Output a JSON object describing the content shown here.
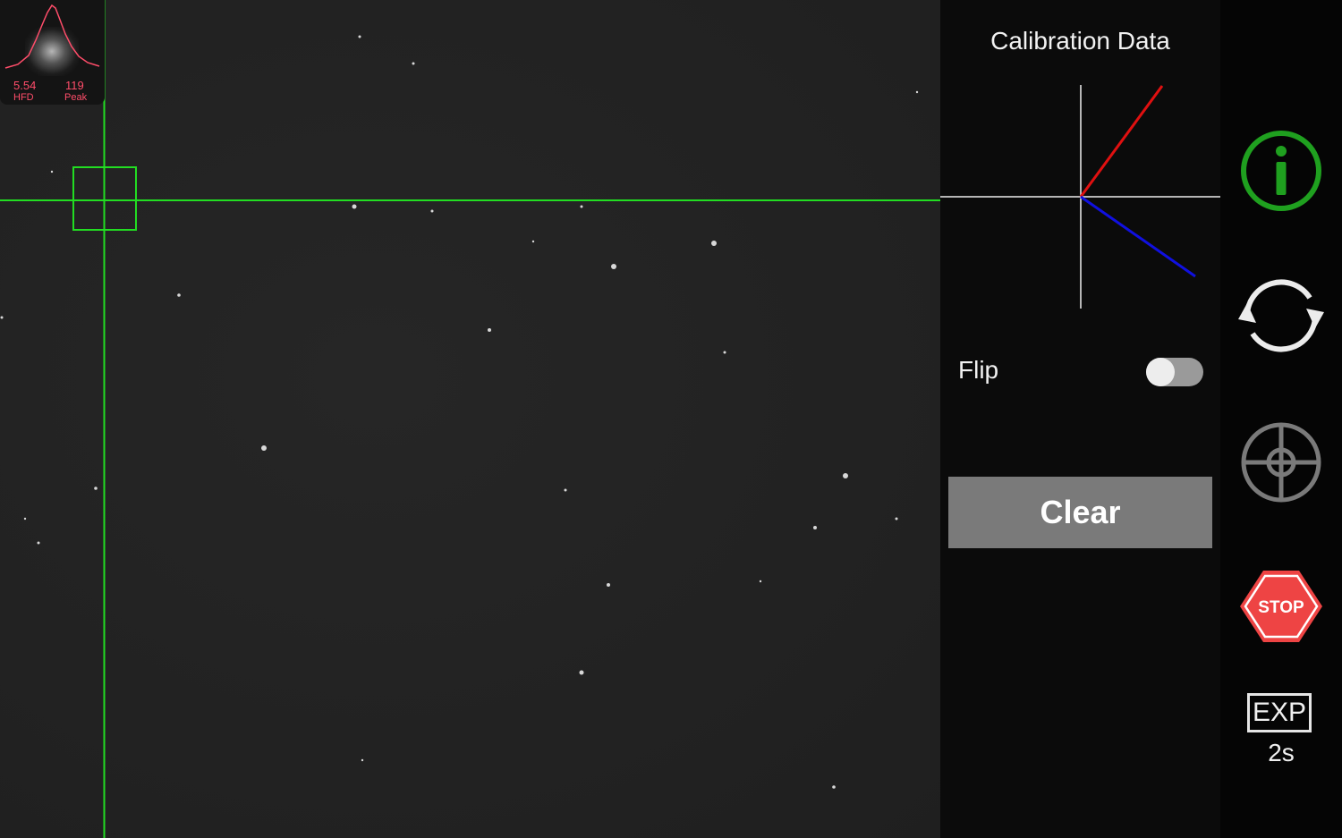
{
  "star_profile": {
    "hfd_value": "5.54",
    "hfd_label": "HFD",
    "peak_value": "119",
    "peak_label": "Peak",
    "curve_color": "#ff4d6a"
  },
  "colors": {
    "crosshair": "#22dd22",
    "axis_red": "#e01010",
    "axis_blue": "#1010e0",
    "info_green": "#1fa01f",
    "stop_red": "#ee4444"
  },
  "calibration": {
    "title": "Calibration Data",
    "flip_label": "Flip",
    "flip_on": false,
    "clear_label": "Clear"
  },
  "toolbar": {
    "icons": [
      "info-icon",
      "refresh-icon",
      "target-icon",
      "stop-icon",
      "exposure-icon"
    ],
    "stop_label": "STOP",
    "exp_label": "EXP",
    "exp_value": "2s"
  }
}
